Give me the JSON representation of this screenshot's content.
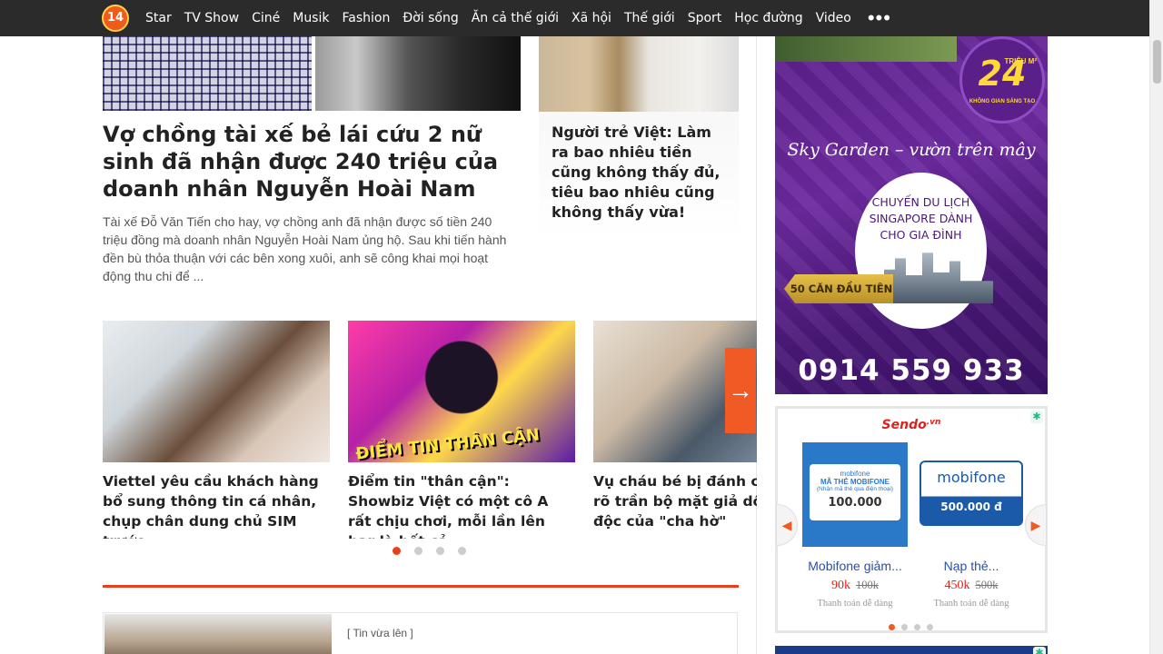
{
  "nav": {
    "logo": "14",
    "items": [
      "Star",
      "TV Show",
      "Ciné",
      "Musik",
      "Fashion",
      "Đời sống",
      "Ăn cả thế giới",
      "Xã hội",
      "Thế giới",
      "Sport",
      "Học đường",
      "Video"
    ],
    "more": "•••"
  },
  "featured": {
    "title": "Vợ chồng tài xế bẻ lái cứu 2 nữ sinh đã nhận được 240 triệu của doanh nhân Nguyễn Hoài Nam",
    "description": "Tài xế Đỗ Văn Tiến cho hay, vợ chồng anh đã nhận được số tiền 240 triệu đồng mà doanh nhân Nguyễn Hoài Nam ủng hộ. Sau khi tiến hành đền bù thỏa thuận với các bên xong xuôi, anh sẽ công khai mọi hoạt động thu chi để ..."
  },
  "side_article": {
    "title": "Người trẻ Việt: Làm ra bao nhiêu tiền cũng không thấy đủ, tiêu bao nhiêu cũng không thấy vừa!"
  },
  "carousel": {
    "items": [
      {
        "title": "Viettel yêu cầu khách hàng bổ sung thông tin cá nhân, chụp chân dung chủ SIM trước ..."
      },
      {
        "title": "Điểm tin \"thân cận\": Showbiz Việt có một cô A rất chịu chơi, mỗi lần lên bar là hết cả ...",
        "image_text": "ĐIỂM TIN THÂN CẬN"
      },
      {
        "title": "Vụ cháu bé bị đánh chết: Lộ rõ trần bộ mặt giả dối, ác độc của \"cha hờ\""
      }
    ],
    "next_icon": "→",
    "pages": 4,
    "active_page": 1
  },
  "news_list": {
    "tag": "[ Tin vừa lên ]"
  },
  "ad_banner": {
    "badge_number": "24",
    "badge_unit": "TRIỆU M²",
    "badge_sub": "KHÔNG GIAN SÁNG TẠO",
    "slogan": "Sky Garden – vườn trên mây",
    "circle_text": "CHUYẾN DU LỊCH SINGAPORE DÀNH CHO GIA ĐÌNH",
    "ribbon": "50 CĂN ĐẦU TIÊN",
    "phone": "0914 559 933"
  },
  "sendo": {
    "logo": "Sendo",
    "logo_suffix": ".vn",
    "adchoice_icon": "✱",
    "products": [
      {
        "card_brand": "mobifone",
        "card_line1": "MÃ THẺ MOBIFONE",
        "card_line2": "(Nhận mã thẻ qua điện thoại)",
        "card_value": "100.000",
        "name": "Mobifone giảm...",
        "price": "90k",
        "old_price": "100k",
        "note": "Thanh toán dễ dàng"
      },
      {
        "card_brand": "mobifone",
        "card_value": "500.000 đ",
        "name": "Nạp thẻ...",
        "price": "450k",
        "old_price": "500k",
        "note": "Thanh toán dễ dàng"
      }
    ],
    "prev_icon": "◀",
    "next_icon": "▶",
    "pages": 4,
    "active_page": 1
  },
  "colors": {
    "nav_bg": "#2b2b2b",
    "accent": "#e8401c",
    "carousel_arrow": "#f15a24",
    "ad_purple": "#5b1f8a"
  }
}
